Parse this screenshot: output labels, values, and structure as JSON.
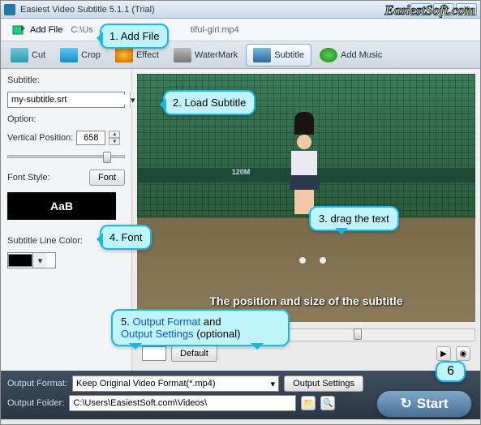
{
  "title": "Easiest Video Subtitle 5.1.1 (Trial)",
  "watermark": "EasiestSoft.com",
  "toolbar": {
    "add_file": "Add File",
    "path_prefix": "C:\\Us",
    "path_suffix": "tiful-girl.mp4"
  },
  "tabs": [
    {
      "label": "Cut",
      "icon": "cut-icon"
    },
    {
      "label": "Crop",
      "icon": "crop-icon"
    },
    {
      "label": "Effect",
      "icon": "effect-icon"
    },
    {
      "label": "WaterMark",
      "icon": "watermark-icon"
    },
    {
      "label": "Subtitle",
      "icon": "subtitle-icon"
    },
    {
      "label": "Add Music",
      "icon": "music-icon"
    }
  ],
  "side": {
    "subtitle_label": "Subtitle:",
    "subtitle_file": "my-subtitle.srt",
    "option_label": "Option:",
    "vpos_label": "Vertical Position:",
    "vpos_value": "658",
    "font_style_label": "Font Style:",
    "font_button": "Font",
    "preview": "AaB",
    "line_color_label": "Subtitle Line Color:"
  },
  "video": {
    "distance": "120M",
    "subtitle": "The position and size of the subtitle"
  },
  "editbar": {
    "default_btn": "Default"
  },
  "bottom": {
    "format_label": "Output Format:",
    "format_value": "Keep Original Video Format(*.mp4)",
    "settings_btn": "Output Settings",
    "folder_label": "Output Folder:",
    "folder_value": "C:\\Users\\EasiestSoft.com\\Videos\\",
    "start": "Start"
  },
  "callouts": {
    "c1": "1. Add File",
    "c2": "2. Load Subtitle",
    "c3": "3. drag the text",
    "c4": "4. Font",
    "c5_pre": "5. ",
    "c5_a": "Output Format",
    "c5_mid": " and ",
    "c5_b": "Output Settings",
    "c5_post": " (optional)",
    "c6": "6"
  }
}
